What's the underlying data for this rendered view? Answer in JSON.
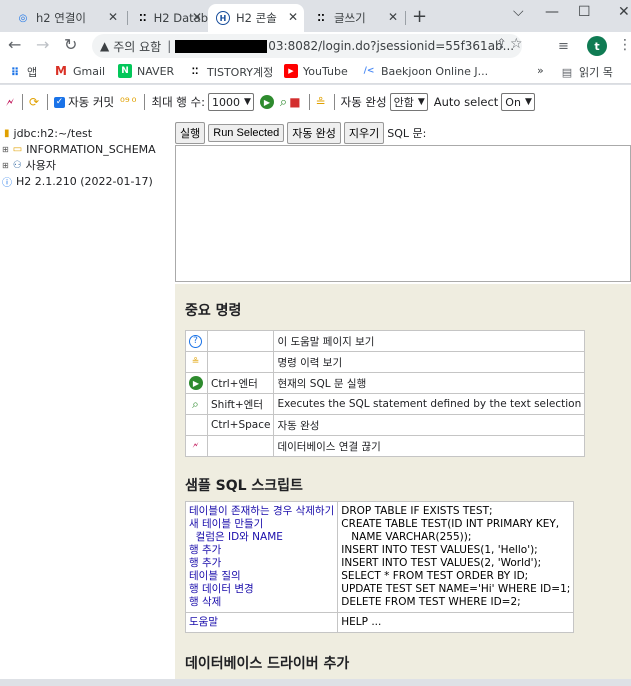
{
  "tabs": [
    {
      "title": "h2 연결이",
      "favicon": "globe-icon",
      "active": false
    },
    {
      "title": "H2 Datab",
      "favicon": "tistory-icon",
      "active": false
    },
    {
      "title": "H2 콘솔",
      "favicon": "h2-icon",
      "active": true
    },
    {
      "title": "글쓰기",
      "favicon": "tistory-icon",
      "active": false
    }
  ],
  "address": {
    "security_label": "주의 요함",
    "url_visible": "03:8082/login.do?jsessionid=55f361ab..."
  },
  "profile": {
    "initial": "t",
    "color": "#0f7b53"
  },
  "bookmarks": [
    {
      "label": "앱",
      "icon": "apps-grid-icon"
    },
    {
      "label": "Gmail",
      "icon": "gmail-icon"
    },
    {
      "label": "NAVER",
      "icon": "naver-icon"
    },
    {
      "label": "TISTORY계정",
      "icon": "tistory-icon"
    },
    {
      "label": "YouTube",
      "icon": "youtube-icon"
    },
    {
      "label": "Baekjoon Online J...",
      "icon": "baekjoon-icon"
    }
  ],
  "bookmarks_overflow": "»",
  "reading_list": "읽기 목",
  "toolbar": {
    "autocommit": "자동 커밋",
    "max_rows_label": "최대 행 수:",
    "max_rows_value": "1000",
    "autocomplete_label": "자동 완성",
    "autocomplete_value": "안함",
    "autoselect_label": "Auto select",
    "autoselect_value": "On"
  },
  "tree": [
    {
      "label": "jdbc:h2:~/test",
      "icon": "database-icon"
    },
    {
      "label": "INFORMATION_SCHEMA",
      "icon": "folder-icon"
    },
    {
      "label": "사용자",
      "icon": "users-icon"
    },
    {
      "label": "H2 2.1.210 (2022-01-17)",
      "icon": "info-icon"
    }
  ],
  "sqlbar": {
    "run": "실행",
    "run_selected": "Run Selected",
    "autocomplete": "자동 완성",
    "clear": "지우기",
    "sql_label": "SQL 문:"
  },
  "help": {
    "important_title": "중요 명령",
    "commands": [
      {
        "icon": "help-icon",
        "key": "",
        "desc": "이 도움말 페이지 보기"
      },
      {
        "icon": "history-icon",
        "key": "",
        "desc": "명령 이력 보기"
      },
      {
        "icon": "run-icon",
        "key": "Ctrl+엔터",
        "desc": "현재의 SQL 문 실행"
      },
      {
        "icon": "run-selected-icon",
        "key": "Shift+엔터",
        "desc": "Executes the SQL statement defined by the text selection"
      },
      {
        "icon": "",
        "key": "Ctrl+Space",
        "desc": "자동 완성"
      },
      {
        "icon": "disconnect-icon",
        "key": "",
        "desc": "데이터베이스 연결 끊기"
      }
    ],
    "sample_title": "샘플 SQL 스크립트",
    "samples": [
      {
        "link": "테이블이 존재하는 경우 삭제하기",
        "code": "DROP TABLE IF EXISTS TEST;"
      },
      {
        "link": "새 테이블 만들기",
        "code": "CREATE TABLE TEST(ID INT PRIMARY KEY,"
      },
      {
        "link": "  컬럼은 ID와 NAME",
        "code": "   NAME VARCHAR(255));"
      },
      {
        "link": "행 추가",
        "code": "INSERT INTO TEST VALUES(1, 'Hello');"
      },
      {
        "link": "행 추가",
        "code": "INSERT INTO TEST VALUES(2, 'World');"
      },
      {
        "link": "테이블 질의",
        "code": "SELECT * FROM TEST ORDER BY ID;"
      },
      {
        "link": "행 데이터 변경",
        "code": "UPDATE TEST SET NAME='Hi' WHERE ID=1;"
      },
      {
        "link": "행 삭제",
        "code": "DELETE FROM TEST WHERE ID=2;"
      }
    ],
    "help_link": "도움말",
    "help_code": "HELP ...",
    "cutoff_title": "데이터베이스 드라이버 추가"
  }
}
